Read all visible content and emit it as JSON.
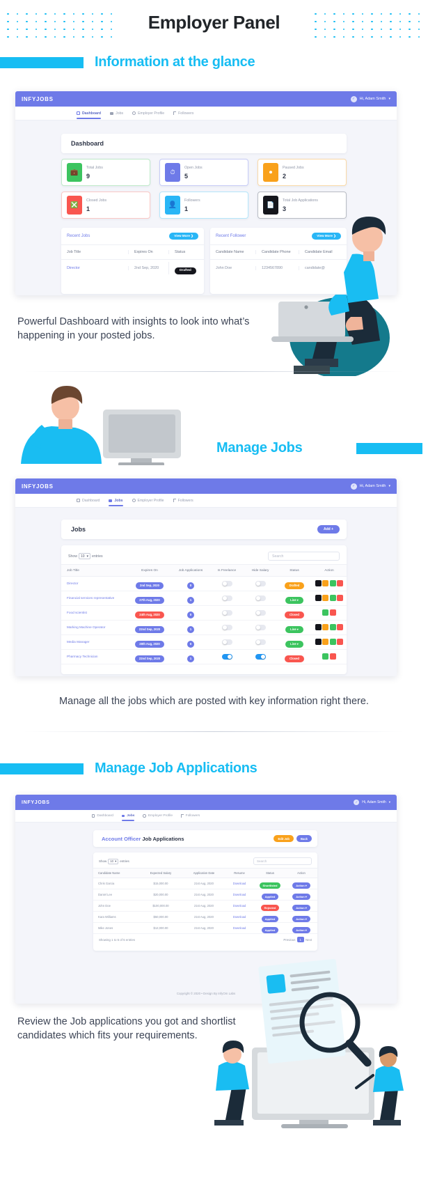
{
  "header": {
    "title": "Employer Panel",
    "dot_color": "#17bdf3"
  },
  "sections": [
    {
      "id": "dashboard",
      "title": "Information at the glance",
      "caption": "Powerful Dashboard with insights to look into what’s happening in your posted jobs."
    },
    {
      "id": "manage-jobs",
      "title": "Manage Jobs",
      "caption": "Manage all the jobs which are posted with key information right there."
    },
    {
      "id": "manage-applications",
      "title": "Manage Job Applications",
      "caption": "Review the Job applications you got and shortlist candidates which fits your requirements."
    }
  ],
  "app": {
    "brand": "INFYJOBS",
    "user": "Hi, Adam Smith",
    "user_caret": "▾",
    "nav": [
      {
        "label": "Dashboard",
        "icon": "dashboard-icon"
      },
      {
        "label": "Jobs",
        "icon": "briefcase-icon"
      },
      {
        "label": "Employer Profile",
        "icon": "user-circle-icon"
      },
      {
        "label": "Followers",
        "icon": "flag-icon"
      }
    ],
    "footer": "Copyright © 2020 • Design By InfyOm Labs"
  },
  "dashboard": {
    "page_title": "Dashboard",
    "stats": [
      {
        "label": "Total Jobs",
        "value": "9",
        "color": "#3cc45f",
        "icon": "briefcase-icon"
      },
      {
        "label": "Open Jobs",
        "value": "5",
        "color": "#6e7ae8",
        "icon": "clock-icon"
      },
      {
        "label": "Paused Jobs",
        "value": "2",
        "color": "#f9a11b",
        "icon": "pause-icon"
      },
      {
        "label": "Closed Jobs",
        "value": "1",
        "color": "#f9564f",
        "icon": "close-box-icon"
      },
      {
        "label": "Followers",
        "value": "1",
        "color": "#29b6f6",
        "icon": "user-icon"
      },
      {
        "label": "Total Job Applications",
        "value": "3",
        "color": "#15161c",
        "icon": "file-icon"
      }
    ],
    "recent_jobs": {
      "title": "Recent Jobs",
      "view_more": "View More ❯",
      "columns": [
        "Job Title",
        "Expires On",
        "Status"
      ],
      "rows": [
        {
          "title": "Director",
          "expires": "2nd Sep, 2020",
          "status": "Drafted"
        }
      ]
    },
    "recent_follower": {
      "title": "Recent Follower",
      "view_more": "View More ❯",
      "columns": [
        "Candidate Name",
        "Candidate Phone",
        "Candidate Email"
      ],
      "rows": [
        {
          "name": "John Doe",
          "phone": "1234567890",
          "email": "candidate@"
        }
      ]
    }
  },
  "jobs": {
    "page_title": "Jobs",
    "add_button": "Add +",
    "show_label": "Show",
    "show_value": "10",
    "entries_label": "entries",
    "search_placeholder": "Search",
    "columns": [
      "Job Title",
      "Expires On",
      "Job Applications",
      "Is Freelance",
      "Hide Salary",
      "Status",
      "Action"
    ],
    "rows": [
      {
        "title": "Director",
        "expires": "2nd Sep, 2020",
        "expires_color": "#6e7ae8",
        "applications": "0",
        "freelance": false,
        "hide_salary": false,
        "status": "Drafted",
        "status_color": "#f9a11b",
        "status_caret": "",
        "actions": [
          "black",
          "orange",
          "green",
          "red"
        ]
      },
      {
        "title": "Financial services representative",
        "expires": "27th Aug, 2020",
        "expires_color": "#6e7ae8",
        "applications": "1",
        "freelance": false,
        "hide_salary": false,
        "status": "Live",
        "status_color": "#3cc45f",
        "status_caret": "▾",
        "actions": [
          "black",
          "orange",
          "green",
          "red"
        ]
      },
      {
        "title": "Food scientist",
        "expires": "24th Aug, 2020",
        "expires_color": "#f9564f",
        "applications": "0",
        "freelance": false,
        "hide_salary": false,
        "status": "Closed",
        "status_color": "#f9564f",
        "status_caret": "",
        "actions": [
          "green",
          "red"
        ]
      },
      {
        "title": "Marking Machine Operator",
        "expires": "22nd Sep, 2020",
        "expires_color": "#6e7ae8",
        "applications": "1",
        "freelance": false,
        "hide_salary": false,
        "status": "Live",
        "status_color": "#3cc45f",
        "status_caret": "▾",
        "actions": [
          "black",
          "orange",
          "green",
          "red"
        ]
      },
      {
        "title": "Media Manager",
        "expires": "28th Aug, 2020",
        "expires_color": "#6e7ae8",
        "applications": "0",
        "freelance": false,
        "hide_salary": false,
        "status": "Live",
        "status_color": "#3cc45f",
        "status_caret": "▾",
        "actions": [
          "black",
          "orange",
          "green",
          "red"
        ]
      },
      {
        "title": "Pharmacy Technician",
        "expires": "22nd Sep, 2020",
        "expires_color": "#6e7ae8",
        "applications": "1",
        "freelance": true,
        "hide_salary": true,
        "status": "Closed",
        "status_color": "#f9564f",
        "status_caret": "",
        "actions": [
          "green",
          "red"
        ]
      }
    ]
  },
  "applications": {
    "page_title_prefix": "Account Officer",
    "page_title_suffix": "Job Applications",
    "edit_button": "Edit Job",
    "back_button": "Back",
    "show_label": "Show",
    "show_value": "10",
    "entries_label": "entries",
    "search_placeholder": "Search",
    "columns": [
      "Candidate Name",
      "Expected Salary",
      "Application Date",
      "Resume",
      "Status",
      "Action"
    ],
    "rows": [
      {
        "name": "Chris Garcia",
        "salary": "$15,000.00",
        "date": "21st Aug, 2020",
        "resume": "Download",
        "status": "Shortlisted",
        "status_color": "#3cc45f",
        "action": "Action ▾"
      },
      {
        "name": "Daniel Lee",
        "salary": "$20,000.00",
        "date": "21st Aug, 2020",
        "resume": "Download",
        "status": "Applied",
        "status_color": "#6e7ae8",
        "action": "Action ▾"
      },
      {
        "name": "John Doe",
        "salary": "$100,000.00",
        "date": "21st Aug, 2020",
        "resume": "Download",
        "status": "Rejected",
        "status_color": "#f9564f",
        "action": "Action ▾"
      },
      {
        "name": "Kara Williams",
        "salary": "$50,000.00",
        "date": "21st Aug, 2020",
        "resume": "Download",
        "status": "Applied",
        "status_color": "#6e7ae8",
        "action": "Action ▾"
      },
      {
        "name": "Mike Jones",
        "salary": "$12,000.00",
        "date": "21st Aug, 2020",
        "resume": "Download",
        "status": "Applied",
        "status_color": "#6e7ae8",
        "action": "Action ▾"
      }
    ],
    "showing": "Showing 1 to 5 of 5 entries",
    "prev": "Previous",
    "page": "1",
    "next": "Next"
  }
}
